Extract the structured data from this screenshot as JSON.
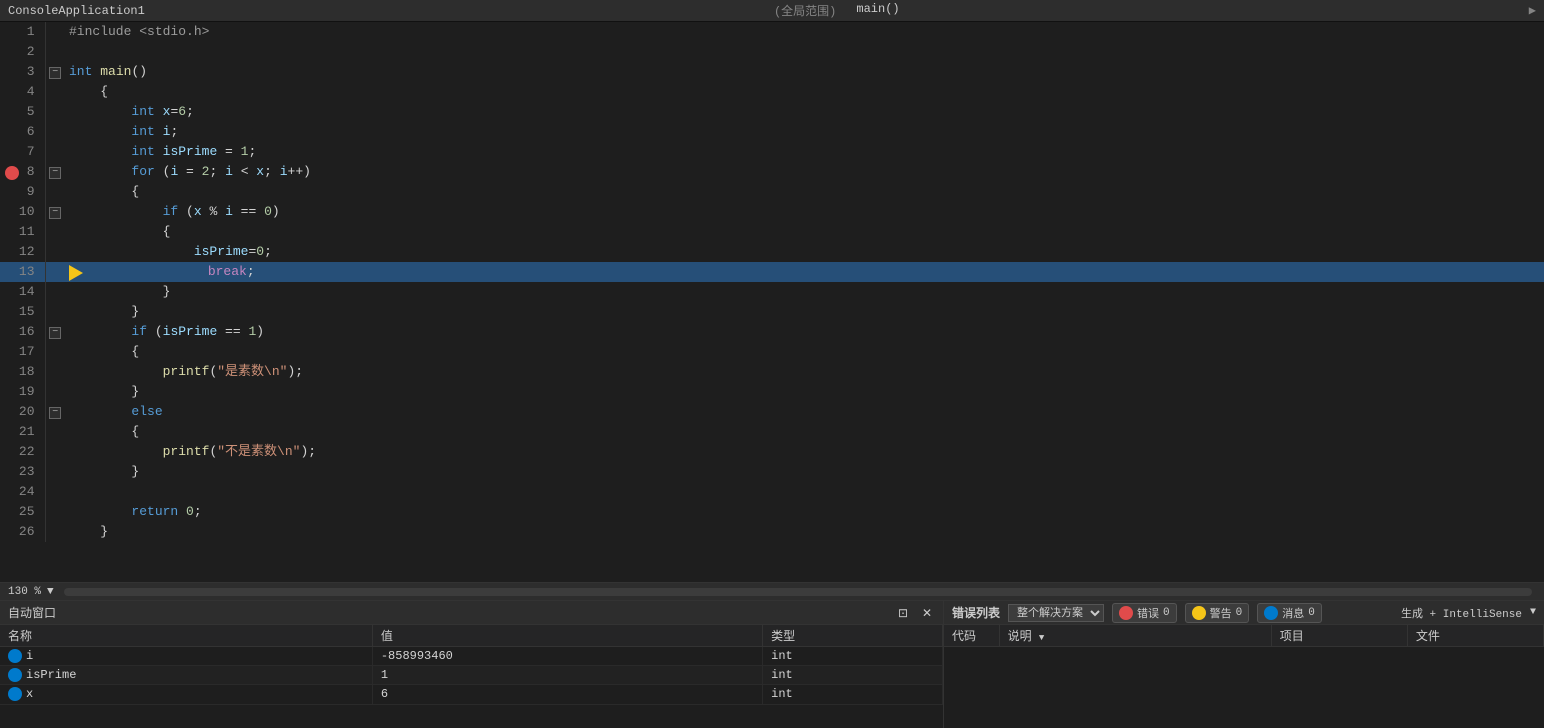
{
  "titleBar": {
    "appName": "ConsoleApplication1",
    "scopeLabel": "(全局范围)",
    "funcLabel": "main()"
  },
  "editor": {
    "lines": [
      {
        "num": 1,
        "gutter": "",
        "content": [
          {
            "t": "pp",
            "v": "#include <stdio.h>"
          }
        ]
      },
      {
        "num": 2,
        "gutter": "",
        "content": []
      },
      {
        "num": 3,
        "gutter": "⊟",
        "content": [
          {
            "t": "kw",
            "v": "int"
          },
          {
            "t": "plain",
            "v": " "
          },
          {
            "t": "fn",
            "v": "main"
          },
          {
            "t": "plain",
            "v": "()"
          }
        ]
      },
      {
        "num": 4,
        "gutter": "",
        "content": [
          {
            "t": "plain",
            "v": "    {"
          }
        ]
      },
      {
        "num": 5,
        "gutter": "",
        "content": [
          {
            "t": "plain",
            "v": "        "
          },
          {
            "t": "kw",
            "v": "int"
          },
          {
            "t": "plain",
            "v": " "
          },
          {
            "t": "var",
            "v": "x"
          },
          {
            "t": "plain",
            "v": "="
          },
          {
            "t": "num",
            "v": "6"
          },
          {
            "t": "plain",
            "v": ";"
          }
        ]
      },
      {
        "num": 6,
        "gutter": "",
        "content": [
          {
            "t": "plain",
            "v": "        "
          },
          {
            "t": "kw",
            "v": "int"
          },
          {
            "t": "plain",
            "v": " "
          },
          {
            "t": "var",
            "v": "i"
          },
          {
            "t": "plain",
            "v": ";"
          }
        ]
      },
      {
        "num": 7,
        "gutter": "",
        "content": [
          {
            "t": "plain",
            "v": "        "
          },
          {
            "t": "kw",
            "v": "int"
          },
          {
            "t": "plain",
            "v": " "
          },
          {
            "t": "var",
            "v": "isPrime"
          },
          {
            "t": "plain",
            "v": " = "
          },
          {
            "t": "num",
            "v": "1"
          },
          {
            "t": "plain",
            "v": ";"
          }
        ]
      },
      {
        "num": 8,
        "gutter": "⊟",
        "content": [
          {
            "t": "plain",
            "v": "        "
          },
          {
            "t": "kw",
            "v": "for"
          },
          {
            "t": "plain",
            "v": " ("
          },
          {
            "t": "var",
            "v": "i"
          },
          {
            "t": "plain",
            "v": " = "
          },
          {
            "t": "num",
            "v": "2"
          },
          {
            "t": "plain",
            "v": "; "
          },
          {
            "t": "var",
            "v": "i"
          },
          {
            "t": "plain",
            "v": " < "
          },
          {
            "t": "var",
            "v": "x"
          },
          {
            "t": "plain",
            "v": "; "
          },
          {
            "t": "var",
            "v": "i"
          },
          {
            "t": "plain",
            "v": "++)"
          }
        ],
        "hasBreakpoint": true
      },
      {
        "num": 9,
        "gutter": "",
        "content": [
          {
            "t": "plain",
            "v": "        {"
          }
        ]
      },
      {
        "num": 10,
        "gutter": "⊟",
        "content": [
          {
            "t": "plain",
            "v": "            "
          },
          {
            "t": "kw",
            "v": "if"
          },
          {
            "t": "plain",
            "v": " ("
          },
          {
            "t": "var",
            "v": "x"
          },
          {
            "t": "plain",
            "v": " % "
          },
          {
            "t": "var",
            "v": "i"
          },
          {
            "t": "plain",
            "v": " == "
          },
          {
            "t": "num",
            "v": "0"
          },
          {
            "t": "plain",
            "v": ")"
          }
        ]
      },
      {
        "num": 11,
        "gutter": "",
        "content": [
          {
            "t": "plain",
            "v": "            {"
          }
        ]
      },
      {
        "num": 12,
        "gutter": "",
        "content": [
          {
            "t": "plain",
            "v": "                "
          },
          {
            "t": "var",
            "v": "isPrime"
          },
          {
            "t": "plain",
            "v": "="
          },
          {
            "t": "num",
            "v": "0"
          },
          {
            "t": "plain",
            "v": ";"
          }
        ]
      },
      {
        "num": 13,
        "gutter": "",
        "content": [
          {
            "t": "plain",
            "v": "                "
          },
          {
            "t": "kw2",
            "v": "break"
          },
          {
            "t": "plain",
            "v": ";"
          }
        ],
        "highlighted": true,
        "hasArrow": true
      },
      {
        "num": 14,
        "gutter": "",
        "content": [
          {
            "t": "plain",
            "v": "            }"
          }
        ]
      },
      {
        "num": 15,
        "gutter": "",
        "content": [
          {
            "t": "plain",
            "v": "        }"
          }
        ]
      },
      {
        "num": 16,
        "gutter": "⊟",
        "content": [
          {
            "t": "plain",
            "v": "        "
          },
          {
            "t": "kw",
            "v": "if"
          },
          {
            "t": "plain",
            "v": " ("
          },
          {
            "t": "var",
            "v": "isPrime"
          },
          {
            "t": "plain",
            "v": " == "
          },
          {
            "t": "num",
            "v": "1"
          },
          {
            "t": "plain",
            "v": ")"
          }
        ]
      },
      {
        "num": 17,
        "gutter": "",
        "content": [
          {
            "t": "plain",
            "v": "        {"
          }
        ]
      },
      {
        "num": 18,
        "gutter": "",
        "content": [
          {
            "t": "plain",
            "v": "            "
          },
          {
            "t": "fn",
            "v": "printf"
          },
          {
            "t": "plain",
            "v": "("
          },
          {
            "t": "str",
            "v": "\"是素数\\n\""
          },
          {
            "t": "plain",
            "v": ");"
          }
        ]
      },
      {
        "num": 19,
        "gutter": "",
        "content": [
          {
            "t": "plain",
            "v": "        }"
          }
        ]
      },
      {
        "num": 20,
        "gutter": "⊟",
        "content": [
          {
            "t": "plain",
            "v": "        "
          },
          {
            "t": "kw",
            "v": "else"
          }
        ]
      },
      {
        "num": 21,
        "gutter": "",
        "content": [
          {
            "t": "plain",
            "v": "        {"
          }
        ]
      },
      {
        "num": 22,
        "gutter": "",
        "content": [
          {
            "t": "plain",
            "v": "            "
          },
          {
            "t": "fn",
            "v": "printf"
          },
          {
            "t": "plain",
            "v": "("
          },
          {
            "t": "str",
            "v": "\"不是素数\\n\""
          },
          {
            "t": "plain",
            "v": ");"
          }
        ]
      },
      {
        "num": 23,
        "gutter": "",
        "content": [
          {
            "t": "plain",
            "v": "        }"
          }
        ]
      },
      {
        "num": 24,
        "gutter": "",
        "content": []
      },
      {
        "num": 25,
        "gutter": "",
        "content": [
          {
            "t": "plain",
            "v": "        "
          },
          {
            "t": "kw",
            "v": "return"
          },
          {
            "t": "plain",
            "v": " "
          },
          {
            "t": "num",
            "v": "0"
          },
          {
            "t": "plain",
            "v": ";"
          }
        ]
      },
      {
        "num": 26,
        "gutter": "",
        "content": [
          {
            "t": "plain",
            "v": "    }"
          }
        ]
      }
    ]
  },
  "zoomBar": {
    "zoomLevel": "130 %"
  },
  "autoWindow": {
    "title": "自动窗口",
    "columns": [
      "名称",
      "值",
      "类型"
    ],
    "rows": [
      {
        "name": "i",
        "value": "-858993460",
        "type": "int"
      },
      {
        "name": "isPrime",
        "value": "1",
        "type": "int"
      },
      {
        "name": "x",
        "value": "6",
        "type": "int"
      }
    ]
  },
  "errorList": {
    "title": "错误列表",
    "scopeLabel": "整个解决方案",
    "errorCount": "0",
    "warningCount": "0",
    "messageCount": "0",
    "errorLabel": "错误",
    "warningLabel": "警告",
    "messageLabel": "消息",
    "buildLabel": "生成 + IntelliSense",
    "columns": [
      "代码",
      "说明",
      "项目",
      "文件"
    ]
  },
  "icons": {
    "chevronDown": "▼",
    "close": "✕",
    "pin": "📌",
    "sortArrow": "▲"
  }
}
